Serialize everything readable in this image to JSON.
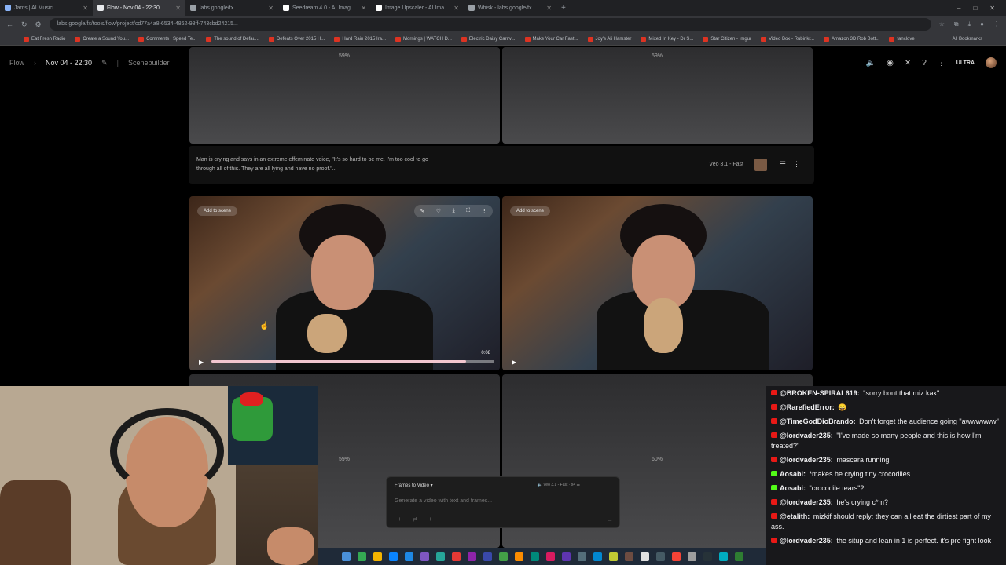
{
  "browser": {
    "tabs": [
      {
        "title": "Jams | AI Music",
        "color": "#8ab4f8",
        "active": false
      },
      {
        "title": "Flow - Nov 04 - 22:30",
        "color": "#e8eaed",
        "active": true
      },
      {
        "title": "labs.google/fx",
        "color": "#9aa0a6",
        "active": false
      },
      {
        "title": "Seedream 4.0 - AI Image Gene",
        "color": "#ffffff",
        "active": false
      },
      {
        "title": "Image Upscaler - AI Image Ups",
        "color": "#ffffff",
        "active": false
      },
      {
        "title": "Whisk - labs.google/fx",
        "color": "#9aa0a6",
        "active": false
      }
    ],
    "new_tab": "+",
    "url": "labs.google/fx/tools/flow/project/cd77a4a8-6534-4862-98ff-743cbd24215...",
    "bookmarks": [
      "Eat Fresh Radio",
      "Create a Sound You...",
      "Comments | Speed Te...",
      "The sound of Defau...",
      "Defeats Over 2015 H...",
      "Hard Rain 2015 Ira...",
      "Mornings | WATCH D...",
      "Electric Daisy Carnv...",
      "Make Your Car Fast...",
      "Joy's Ali Hamster",
      "Mixed In Key - Dr S...",
      "Star Citizen - Imgur",
      "Video Box - Rubinkr...",
      "Amazon 3D Rob Bott...",
      "fanclove"
    ],
    "all_bookmarks": "All Bookmarks"
  },
  "app": {
    "breadcrumb_root": "Flow",
    "project_name": "Nov 04 - 22:30",
    "section": "Scenebuilder",
    "plan_badge": "ULTRA"
  },
  "top_row": {
    "left_pct": "59%",
    "right_pct": "59%"
  },
  "prompt_row": {
    "text": "Man is crying and says in an extreme effeminate voice, \"It's so hard to be me. I'm too cool to go through all of this. They are all lying and have no proof.\"...",
    "model": "Veo 3.1 - Fast"
  },
  "video_row": {
    "add_label_left": "Add to scene",
    "add_label_right": "Add to scene",
    "time": "0:08",
    "progress_fraction": 0.9
  },
  "bottom_row": {
    "left_pct": "59%",
    "right_pct": "60%"
  },
  "composer": {
    "mode": "Frames to Video",
    "model": "Veo 3.1 - Fast",
    "count": "x4",
    "placeholder": "Generate a video with text and frames..."
  },
  "chat": [
    {
      "user": "@BROKEN-SPIRAL619:",
      "text": " \"sorry bout that miz kak\"",
      "badge": "#e91916"
    },
    {
      "user": "@RarefiedError:",
      "text": " 😀",
      "badge": "#e91916"
    },
    {
      "user": "@TimeGodDioBrando:",
      "text": " Don't forget the audience going \"awwwwww\"",
      "badge": "#e91916"
    },
    {
      "user": "@lordvader235:",
      "text": " \"I've made so many people and this is how I'm treated?\"",
      "badge": "#e91916"
    },
    {
      "user": "@lordvader235:",
      "text": " mascara running",
      "badge": "#e91916"
    },
    {
      "user": "Aosabi:",
      "text": " *makes he crying tiny crocodiles",
      "badge": "#53fc18"
    },
    {
      "user": "Aosabi:",
      "text": " \"crocodile tears\"?",
      "badge": "#53fc18"
    },
    {
      "user": "@lordvader235:",
      "text": " he's crying c*m?",
      "badge": "#e91916"
    },
    {
      "user": "@etalith:",
      "text": " mizkif should reply: they can all eat the dirtiest part of my ass.",
      "badge": "#e91916"
    },
    {
      "user": "@lordvader235:",
      "text": " the situp and lean in 1 is perfect. it's pre fight look",
      "badge": "#e91916"
    }
  ],
  "taskbar_colors": [
    "#4a90d9",
    "#34a853",
    "#f4b400",
    "#0a84ff",
    "#1e88e5",
    "#7e57c2",
    "#26a69a",
    "#e53935",
    "#8e24aa",
    "#3949ab",
    "#43a047",
    "#fb8c00",
    "#00897b",
    "#d81b60",
    "#5e35b1",
    "#546e7a",
    "#0288d1",
    "#c0ca33",
    "#6d4c41",
    "#e0e0e0",
    "#455a64",
    "#f44336",
    "#9e9e9e",
    "#263238",
    "#00acc1",
    "#2e7d32"
  ]
}
